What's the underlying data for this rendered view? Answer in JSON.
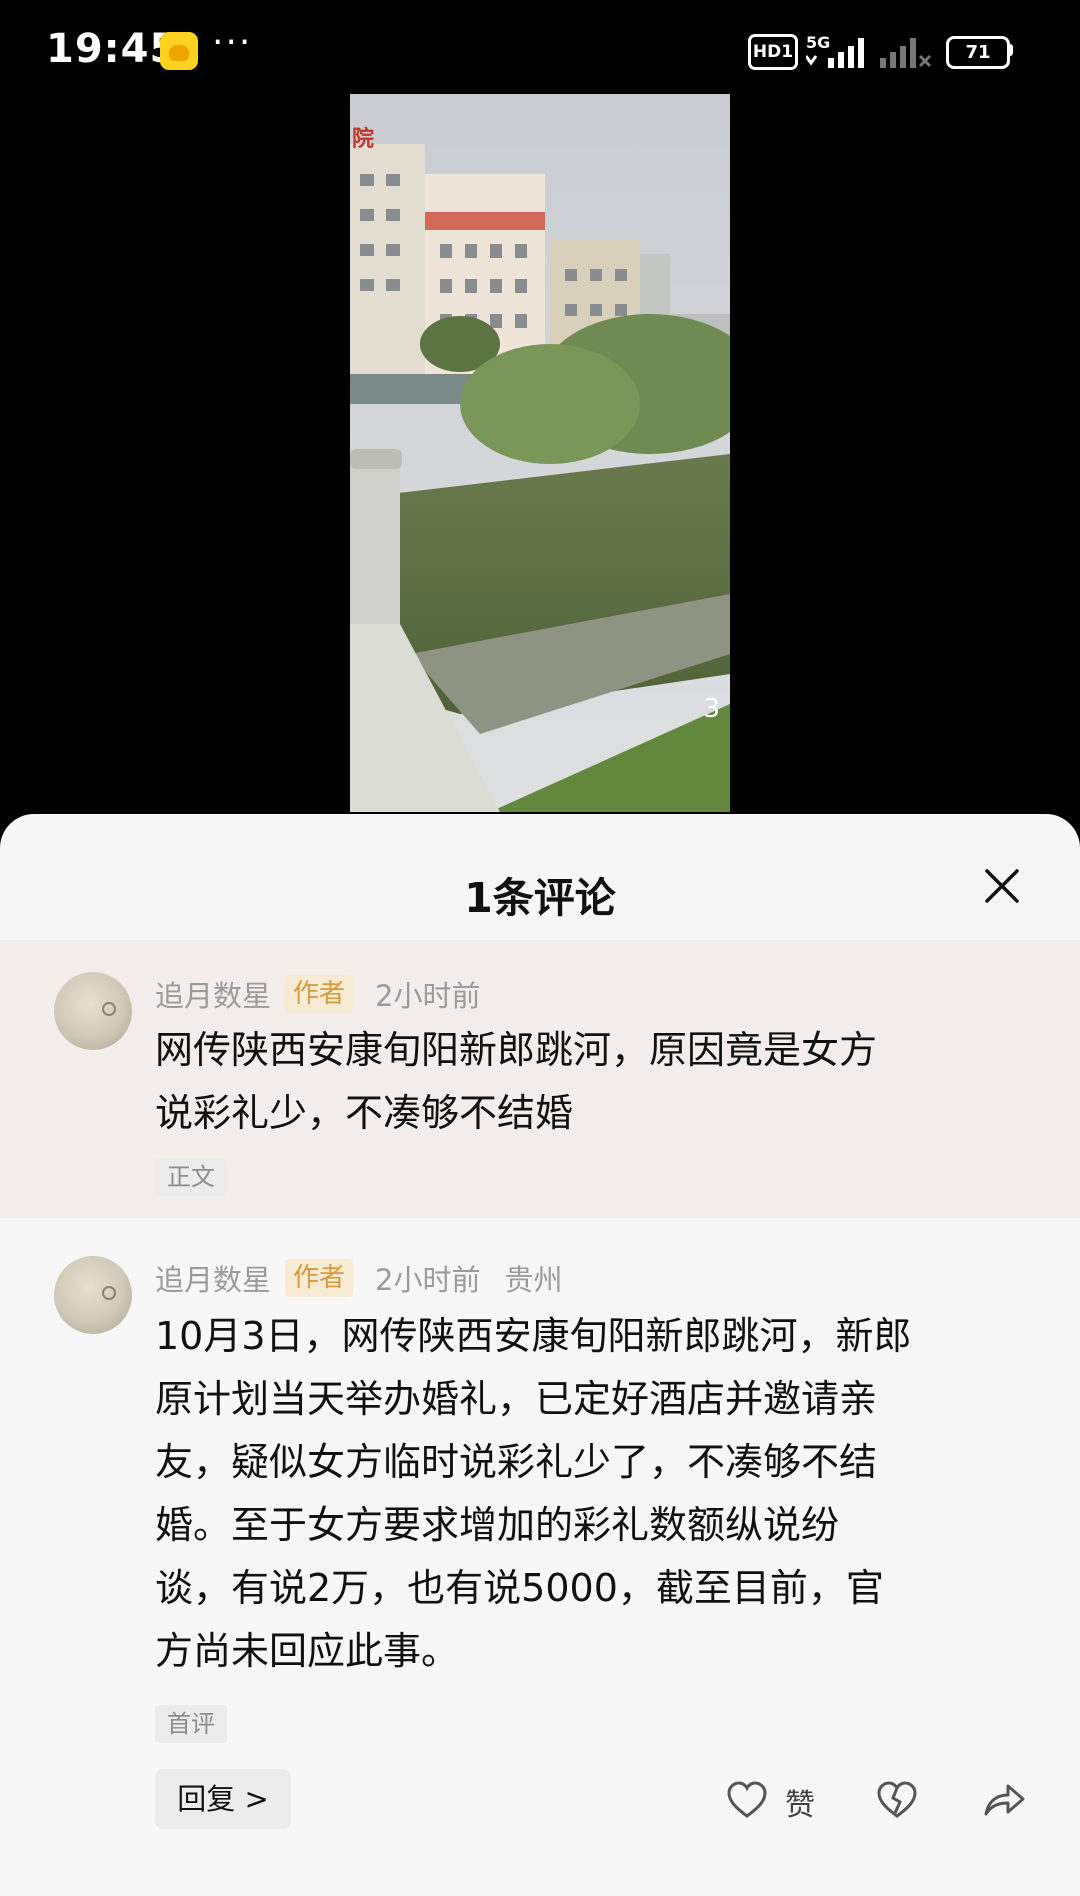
{
  "status_bar": {
    "time": "19:45",
    "more": "···",
    "hd": "HD1",
    "network": "5G",
    "battery": "71"
  },
  "video": {
    "page_number": "3",
    "hospital_sign": "院"
  },
  "sheet": {
    "title": "1条评论",
    "close_icon": "close-icon"
  },
  "comments": [
    {
      "author": "追月数星",
      "badge": "作者",
      "time": "2小时前",
      "location": "",
      "text_lines": [
        "网传陕西安康旬阳新郎跳河，原因竟是女方",
        "说彩礼少，不凑够不结婚"
      ],
      "tag": "正文"
    },
    {
      "author": "追月数星",
      "badge": "作者",
      "time": "2小时前",
      "location": "贵州",
      "text_lines": [
        "10月3日，网传陕西安康旬阳新郎跳河，新郎",
        "原计划当天举办婚礼，已定好酒店并邀请亲",
        "友，疑似女方临时说彩礼少了，不凑够不结",
        "婚。至于女方要求增加的彩礼数额纵说纷",
        "谈，有说2万，也有说5000，截至目前，官",
        "方尚未回应此事。"
      ],
      "tag": "首评"
    }
  ],
  "actions": {
    "reply_label": "回复",
    "reply_chevron": ">",
    "like_label": "赞",
    "like_icon": "heart-icon",
    "dislike_icon": "broken-heart-icon",
    "share_icon": "share-icon"
  }
}
